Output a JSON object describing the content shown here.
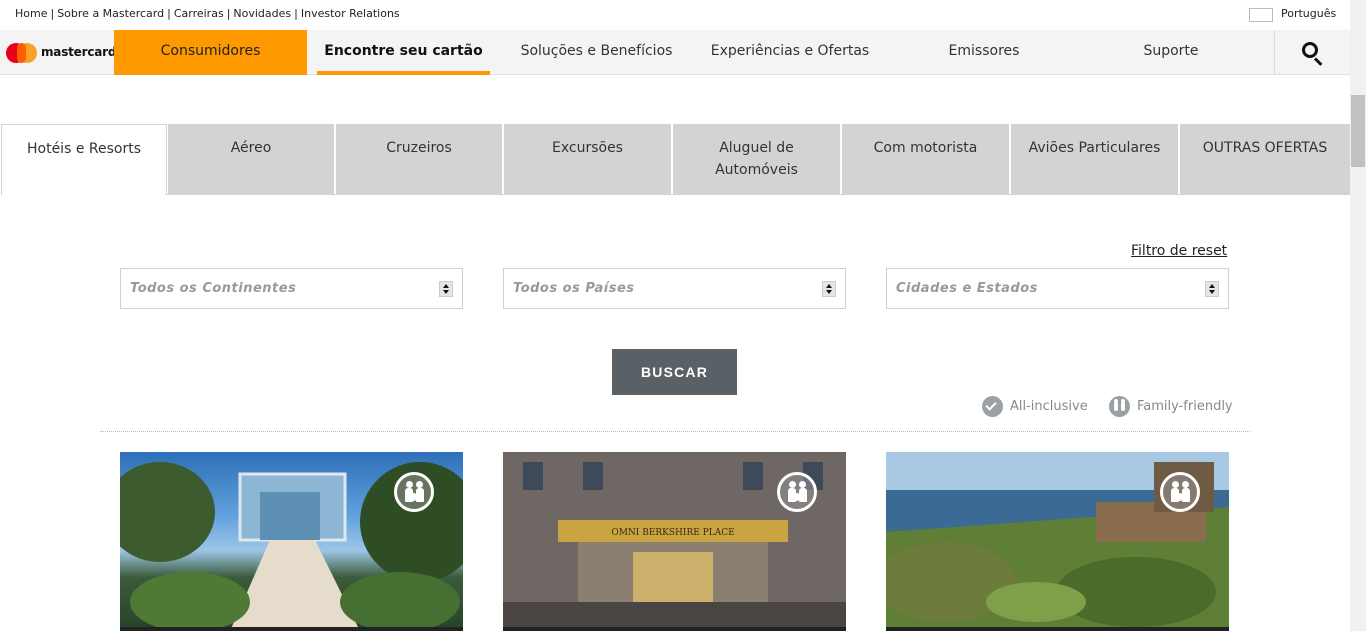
{
  "utility": {
    "links": [
      "Home",
      "Sobre a Mastercard",
      "Carreiras",
      "Novidades",
      "Investor Relations"
    ],
    "language": "Português"
  },
  "nav": {
    "logo_text": "mastercard",
    "items": [
      "Consumidores",
      "Encontre seu cartão",
      "Soluções e Benefícios",
      "Experiências e Ofertas",
      "Emissores",
      "Suporte"
    ],
    "accent_color": "#ff9900"
  },
  "tabs": [
    "Hotéis e Resorts",
    "Aéreo",
    "Cruzeiros",
    "Excursões",
    "Aluguel de Automóveis",
    "Com motorista",
    "Aviões Particulares",
    "OUTRAS OFERTAS"
  ],
  "filters": {
    "reset": "Filtro de reset",
    "continents": "Todos os Continentes",
    "countries": "Todos os Países",
    "cities": "Cidades e Estados",
    "search_button": "BUSCAR"
  },
  "legend": {
    "all_inclusive": "All-inclusive",
    "family_friendly": "Family-friendly"
  },
  "cards": [
    {
      "badge": "family-icon"
    },
    {
      "badge": "family-icon",
      "sign": "OMNI BERKSHIRE PLACE"
    },
    {
      "badge": "family-icon"
    }
  ]
}
